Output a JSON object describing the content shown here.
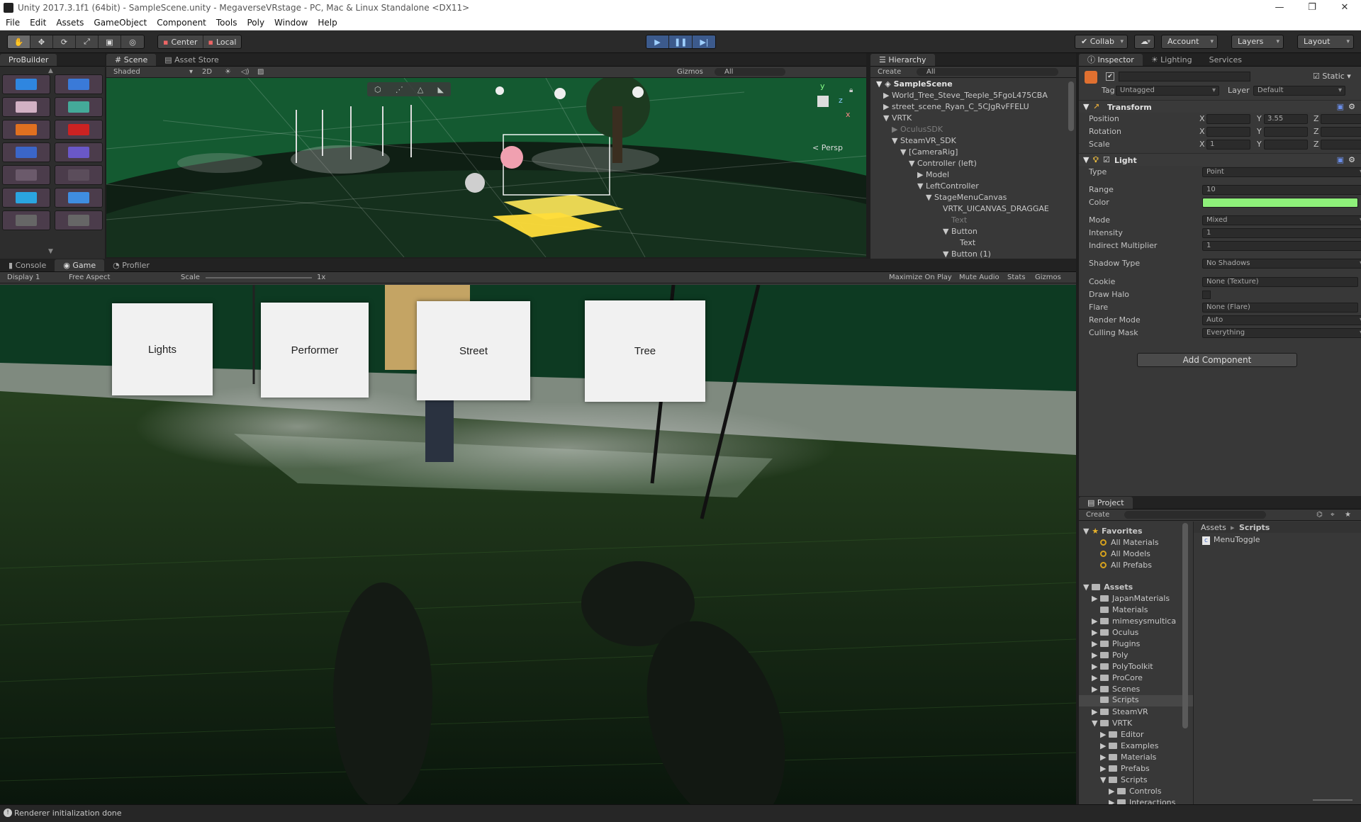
{
  "window": {
    "title": "Unity 2017.3.1f1 (64bit) - SampleScene.unity - MegaverseVRstage - PC, Mac & Linux Standalone <DX11>",
    "minimize": "—",
    "maximize": "❐",
    "close": "✕"
  },
  "menu": [
    "File",
    "Edit",
    "Assets",
    "GameObject",
    "Component",
    "Tools",
    "Poly",
    "Window",
    "Help"
  ],
  "toolbar": {
    "pivot": "Center",
    "space": "Local",
    "collab": "Collab",
    "account": "Account",
    "layers": "Layers",
    "layout": "Layout"
  },
  "probuilder": {
    "tab": "ProBuilder"
  },
  "scene": {
    "tabs": [
      "Scene",
      "Asset Store"
    ],
    "shading": "Shaded",
    "mode2d": "2D",
    "gizmos": "Gizmos",
    "search": "All",
    "persp": "Persp",
    "axis_y": "y",
    "axis_z": "z",
    "axis_x": "x"
  },
  "hierarchy": {
    "tab": "Hierarchy",
    "create": "Create",
    "search": "All",
    "rows": [
      {
        "label": "SampleScene"
      },
      {
        "label": "World_Tree_Steve_Teeple_5FgoL475CBA"
      },
      {
        "label": "street_scene_Ryan_C_5CJgRvFFELU"
      },
      {
        "label": "VRTK"
      },
      {
        "label": "OculusSDK"
      },
      {
        "label": "SteamVR_SDK"
      },
      {
        "label": "[CameraRig]"
      },
      {
        "label": "Controller (left)"
      },
      {
        "label": "Model"
      },
      {
        "label": "LeftController"
      },
      {
        "label": "StageMenuCanvas"
      },
      {
        "label": "VRTK_UICANVAS_DRAGGAE"
      },
      {
        "label": "Text"
      },
      {
        "label": "Button"
      },
      {
        "label": "Text"
      },
      {
        "label": "Button (1)"
      }
    ]
  },
  "game": {
    "tabs": [
      "Console",
      "Game",
      "Profiler"
    ],
    "display": "Display 1",
    "aspect": "Free Aspect",
    "scale_label": "Scale",
    "scale_value": "1x",
    "maximize": "Maximize On Play",
    "mute": "Mute Audio",
    "stats": "Stats",
    "gizmos": "Gizmos",
    "cards": [
      "Lights",
      "Performer",
      "Street",
      "Tree"
    ]
  },
  "inspector": {
    "tabs": [
      "Inspector",
      "Lighting",
      "Services"
    ],
    "static": "Static",
    "tag_label": "Tag",
    "tag_value": "Untagged",
    "layer_label": "Layer",
    "layer_value": "Default",
    "transform": {
      "title": "Transform",
      "rows": [
        {
          "label": "Position",
          "x": "",
          "y": "3.55",
          "z": ""
        },
        {
          "label": "Rotation",
          "x": "",
          "y": "",
          "z": ""
        },
        {
          "label": "Scale",
          "x": "1",
          "y": "",
          "z": ""
        }
      ],
      "axis_x": "X",
      "axis_y": "Y",
      "axis_z": "Z"
    },
    "light": {
      "title": "Light",
      "type_label": "Type",
      "type_value": "Point",
      "range_label": "Range",
      "range_value": "10",
      "color_label": "Color",
      "color_value": "#8ef07a",
      "mode_label": "Mode",
      "mode_value": "Mixed",
      "intensity_label": "Intensity",
      "intensity_value": "1",
      "indirect_label": "Indirect Multiplier",
      "indirect_value": "1",
      "shadow_label": "Shadow Type",
      "shadow_value": "No Shadows",
      "cookie_label": "Cookie",
      "cookie_value": "None (Texture)",
      "halo_label": "Draw Halo",
      "flare_label": "Flare",
      "flare_value": "None (Flare)",
      "render_label": "Render Mode",
      "render_value": "Auto",
      "culling_label": "Culling Mask",
      "culling_value": "Everything"
    },
    "add_component": "Add Component"
  },
  "project": {
    "tab": "Project",
    "create": "Create",
    "breadcrumb_root": "Assets",
    "breadcrumb_current": "Scripts",
    "favorites_label": "Favorites",
    "favorites": [
      "All Materials",
      "All Models",
      "All Prefabs"
    ],
    "assets_label": "Assets",
    "folders": [
      {
        "label": "JapanMaterials"
      },
      {
        "label": "Materials"
      },
      {
        "label": "mimesysmultica"
      },
      {
        "label": "Oculus"
      },
      {
        "label": "Plugins"
      },
      {
        "label": "Poly"
      },
      {
        "label": "PolyToolkit"
      },
      {
        "label": "ProCore"
      },
      {
        "label": "Scenes"
      },
      {
        "label": "Scripts"
      },
      {
        "label": "SteamVR"
      },
      {
        "label": "VRTK"
      },
      {
        "label": "Editor"
      },
      {
        "label": "Examples"
      },
      {
        "label": "Materials"
      },
      {
        "label": "Prefabs"
      },
      {
        "label": "Scripts"
      },
      {
        "label": "Controls"
      },
      {
        "label": "Interactions"
      }
    ],
    "files": [
      "MenuToggle"
    ]
  },
  "status": {
    "message": "Renderer initialization done"
  },
  "colors": {
    "accent": "#3c5a8c",
    "light_color": "#8ef07a",
    "selection": "#3e5f96"
  }
}
